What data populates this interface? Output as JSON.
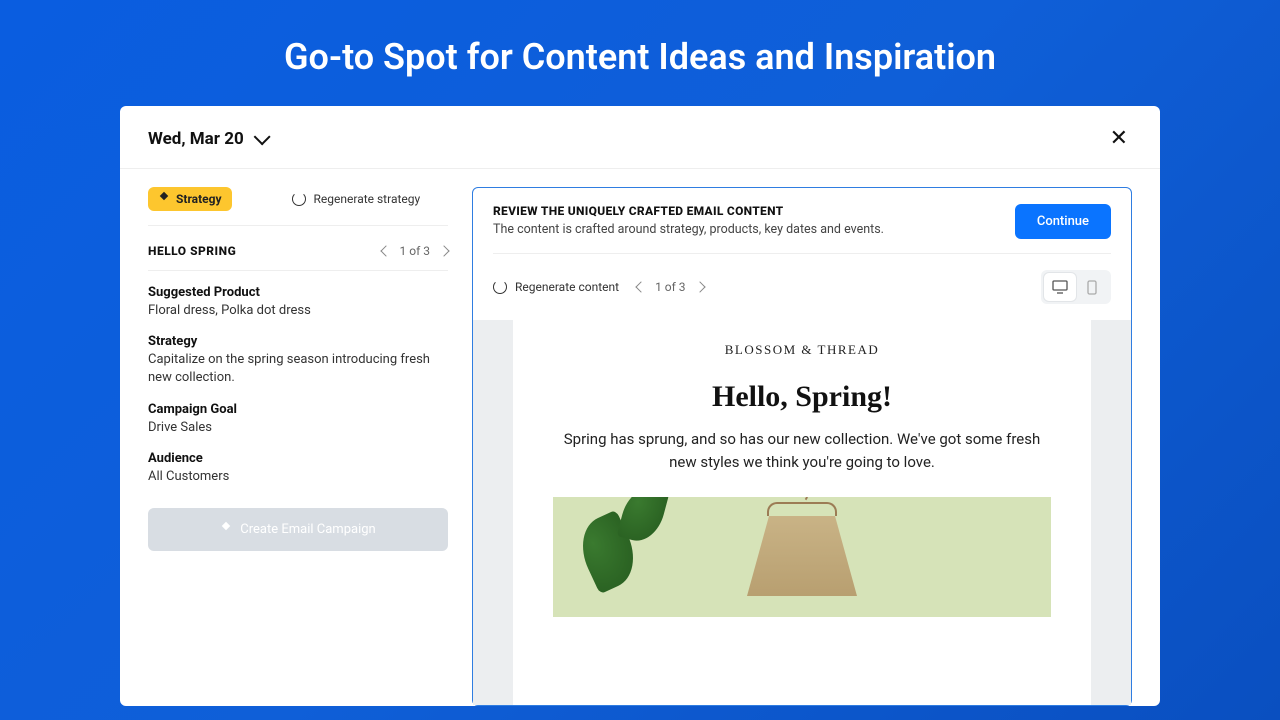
{
  "hero": {
    "title": "Go-to Spot for Content Ideas and Inspiration"
  },
  "header": {
    "date": "Wed, Mar 20"
  },
  "sidebar": {
    "strategy_chip": "Strategy",
    "regenerate": "Regenerate strategy",
    "campaign_name": "HELLO SPRING",
    "pager": "1 of 3",
    "fields": {
      "product_label": "Suggested Product",
      "product_value": "Floral dress, Polka dot dress",
      "strategy_label": "Strategy",
      "strategy_value": "Capitalize on the spring season introducing fresh new collection.",
      "goal_label": "Campaign Goal",
      "goal_value": "Drive Sales",
      "audience_label": "Audience",
      "audience_value": "All Customers"
    },
    "create_button": "Create Email Campaign"
  },
  "review": {
    "title": "REVIEW THE UNIQUELY CRAFTED EMAIL CONTENT",
    "subtitle": "The content is crafted around strategy, products, key dates and events.",
    "continue": "Continue",
    "regenerate_content": "Regenerate  content",
    "pager": "1 of 3"
  },
  "email": {
    "brand": "BLOSSOM & THREAD",
    "heading": "Hello, Spring!",
    "body": "Spring has sprung, and so has our new collection. We've got some fresh new styles we think you're going to love."
  }
}
